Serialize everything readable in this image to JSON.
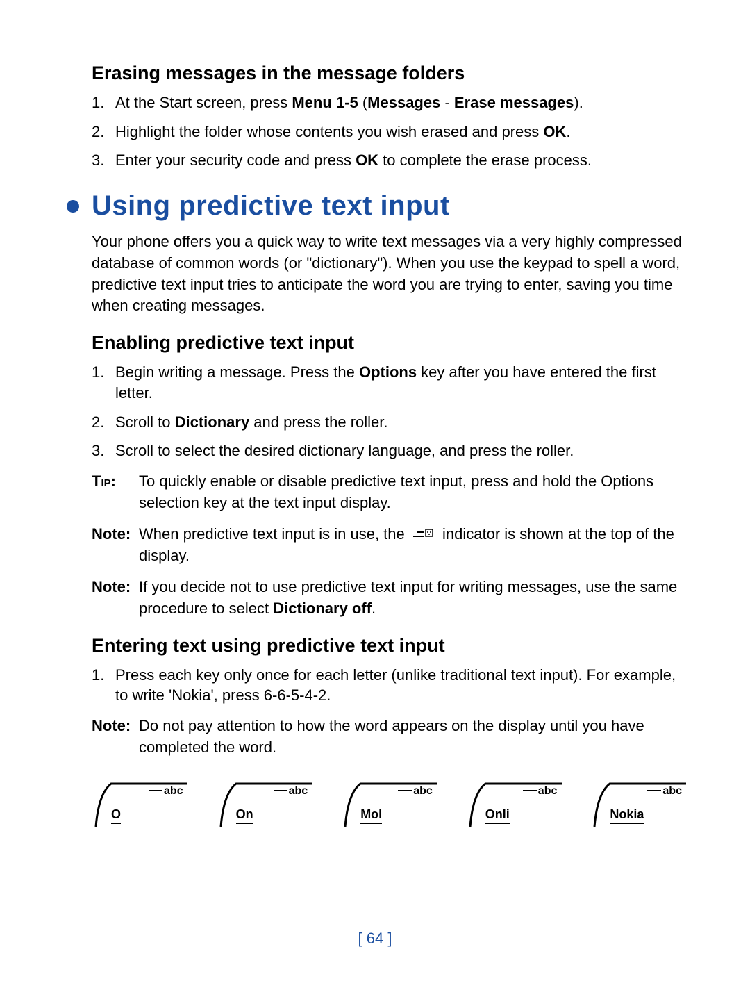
{
  "heading1": "Erasing messages in the message folders",
  "list1": [
    {
      "num": "1.",
      "pre": "At the Start screen, press ",
      "b1": "Menu 1-5",
      "mid": " (",
      "b2": "Messages",
      "mid2": " - ",
      "b3": "Erase messages",
      "post": ")."
    },
    {
      "num": "2.",
      "pre": "Highlight the folder whose contents you wish erased and press ",
      "b1": "OK",
      "post": "."
    },
    {
      "num": "3.",
      "pre": "Enter your security code and press ",
      "b1": "OK",
      "post": " to complete the erase process."
    }
  ],
  "section_title": "Using predictive text input",
  "intro_para": "Your phone offers you a quick way to write text messages via a very highly compressed database of common words (or \"dictionary\"). When you use the keypad to spell a word, predictive text input tries to anticipate the word you are trying to enter, saving you time when creating messages.",
  "heading2": "Enabling predictive text input",
  "list2": [
    {
      "num": "1.",
      "pre": "Begin writing a message. Press the ",
      "b1": "Options",
      "post": " key after you have entered the first letter."
    },
    {
      "num": "2.",
      "pre": "Scroll to ",
      "b1": "Dictionary",
      "post": " and press the roller."
    },
    {
      "num": "3.",
      "pre": "Scroll to select the desired dictionary language, and press the roller.",
      "b1": "",
      "post": ""
    }
  ],
  "tip_label": "Tip:",
  "tip_text": "To quickly enable or disable predictive text input, press and hold the Options selection key at the text input display.",
  "note1_label": "Note:",
  "note1_pre": "When predictive text input is in use, the ",
  "note1_post": " indicator is shown at the top of the display.",
  "note2_label": "Note:",
  "note2_pre": "If you decide not to use predictive text input for writing messages, use the same procedure to select ",
  "note2_b": "Dictionary off",
  "note2_post": ".",
  "heading3": "Entering text using predictive text input",
  "list3_1_num": "1.",
  "list3_1_text": "Press each key only once for each letter (unlike traditional text input). For example, to write 'Nokia', press 6-6-5-4-2.",
  "note3_label": "Note:",
  "note3_text": "Do not pay attention to how the word appears on the display until you have completed the word.",
  "pred_abc": "abc",
  "pred_words": [
    "O",
    "On",
    "Mol",
    "Onli",
    "Nokia"
  ],
  "page_number": "[ 64 ]"
}
